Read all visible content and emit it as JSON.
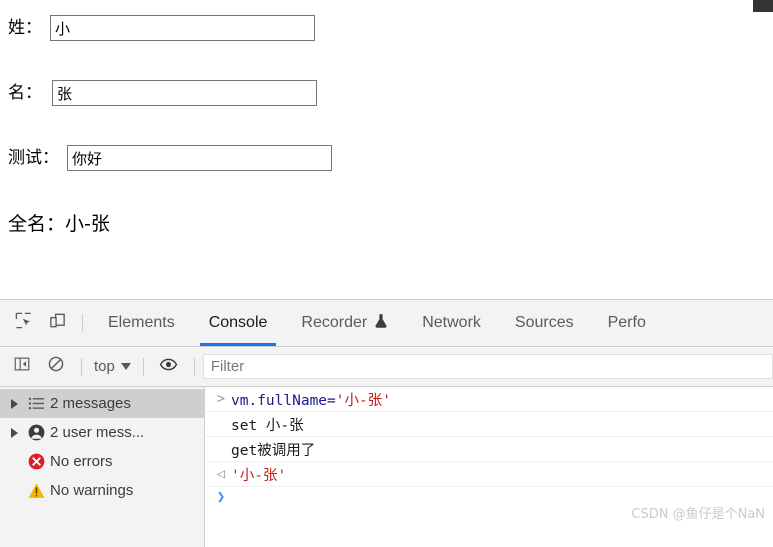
{
  "page": {
    "fields": [
      {
        "label": "姓：",
        "value": "小",
        "name": "surname"
      },
      {
        "label": "名：",
        "value": "张",
        "name": "givenname"
      },
      {
        "label": "测试：",
        "value": "你好",
        "name": "test"
      }
    ],
    "fullname_label": "全名：",
    "fullname_value": "小-张"
  },
  "devtools": {
    "tabs": [
      {
        "label": "Elements",
        "active": false,
        "icon": ""
      },
      {
        "label": "Console",
        "active": true,
        "icon": ""
      },
      {
        "label": "Recorder",
        "active": false,
        "icon": "flask-icon"
      },
      {
        "label": "Network",
        "active": false,
        "icon": ""
      },
      {
        "label": "Sources",
        "active": false,
        "icon": ""
      },
      {
        "label": "Perfo",
        "active": false,
        "icon": ""
      }
    ],
    "tabbar_icons": [
      {
        "name": "inspect-element-icon"
      },
      {
        "name": "device-toolbar-icon"
      }
    ],
    "console_toolbar": {
      "sidebar_toggle_icon": "console-sidebar-toggle-icon",
      "clear_console_icon": "clear-console-icon",
      "context_value": "top",
      "live_expression_icon": "eye-icon",
      "filter_placeholder": "Filter",
      "filter_value": ""
    },
    "console_sidebar": [
      {
        "label": "2 messages",
        "icon": "list-icon",
        "expandable": true,
        "selected": true
      },
      {
        "label": "2 user mess...",
        "icon": "user-icon",
        "expandable": true,
        "selected": false
      },
      {
        "label": "No errors",
        "icon": "error-icon",
        "expandable": false,
        "selected": false
      },
      {
        "label": "No warnings",
        "icon": "warning-icon",
        "expandable": false,
        "selected": false
      }
    ],
    "console_lines": [
      {
        "gutter": ">",
        "gutter_kind": "input",
        "segments": [
          {
            "text": "vm.fullName=",
            "kind": "code"
          },
          {
            "text": "'小-张'",
            "kind": "string"
          }
        ]
      },
      {
        "gutter": "",
        "gutter_kind": "none",
        "segments": [
          {
            "text": "set 小-张",
            "kind": "plain"
          }
        ]
      },
      {
        "gutter": "",
        "gutter_kind": "none",
        "segments": [
          {
            "text": "get被调用了",
            "kind": "plain"
          }
        ]
      },
      {
        "gutter": "◁",
        "gutter_kind": "output",
        "segments": [
          {
            "text": "'小-张'",
            "kind": "string"
          }
        ]
      },
      {
        "gutter": "❯",
        "gutter_kind": "prompt",
        "segments": []
      }
    ]
  },
  "watermark": "CSDN @鱼仔是个NaN",
  "colors": {
    "accent": "#1a73e8",
    "string": "#c41a16",
    "code": "#1a1a8c",
    "error": "#d93025",
    "warning": "#f4b400"
  }
}
